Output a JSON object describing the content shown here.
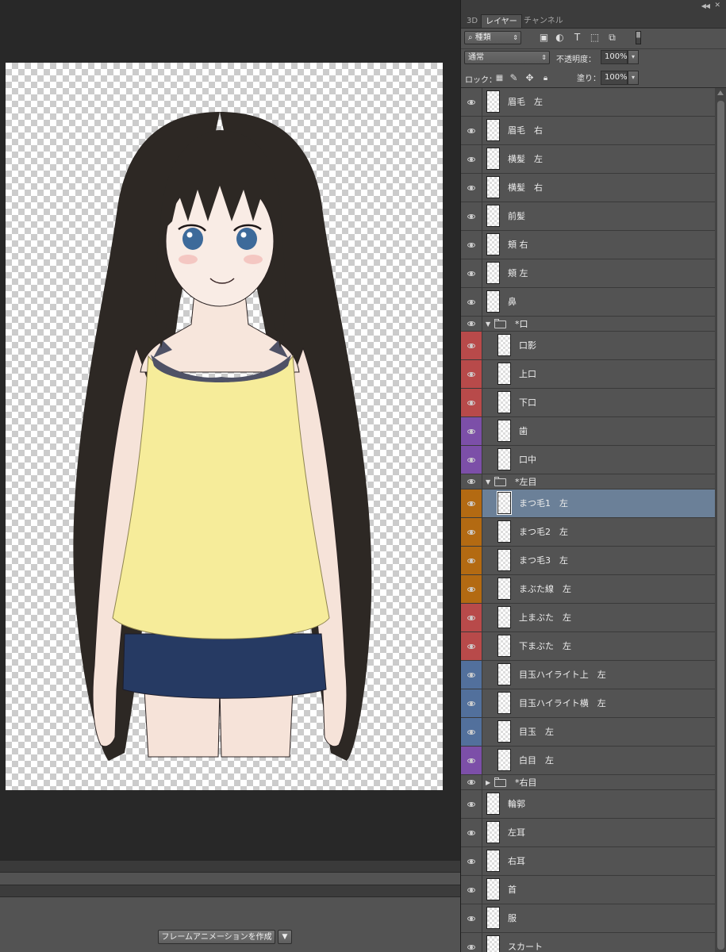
{
  "panel": {
    "tabs": [
      {
        "label": "3D"
      },
      {
        "label": "レイヤー"
      },
      {
        "label": "チャンネル"
      }
    ],
    "collapse_icon": "double-chevron-icon",
    "filter": {
      "label": "種類"
    },
    "blend_mode": {
      "value": "通常"
    },
    "opacity": {
      "label": "不透明度：",
      "value": "100%"
    },
    "lock": {
      "label": "ロック："
    },
    "fill": {
      "label": "塗り：",
      "value": "100%"
    }
  },
  "layers": [
    {
      "name": "眉毛　左",
      "color": "",
      "type": "layer"
    },
    {
      "name": "眉毛　右",
      "color": "",
      "type": "layer"
    },
    {
      "name": "横髪　左",
      "color": "",
      "type": "layer"
    },
    {
      "name": "横髪　右",
      "color": "",
      "type": "layer"
    },
    {
      "name": "前髪",
      "color": "",
      "type": "layer"
    },
    {
      "name": "頬 右",
      "color": "",
      "type": "layer"
    },
    {
      "name": "頬 左",
      "color": "",
      "type": "layer"
    },
    {
      "name": "鼻",
      "color": "",
      "type": "layer"
    },
    {
      "name": "*口",
      "color": "",
      "type": "group",
      "expanded": true
    },
    {
      "name": "口影",
      "color": "#b84a4a",
      "type": "child"
    },
    {
      "name": "上口",
      "color": "#b84a4a",
      "type": "child"
    },
    {
      "name": "下口",
      "color": "#b84a4a",
      "type": "child"
    },
    {
      "name": "歯",
      "color": "#7c4fa8",
      "type": "child"
    },
    {
      "name": "口中",
      "color": "#7c4fa8",
      "type": "child"
    },
    {
      "name": "*左目",
      "color": "",
      "type": "group",
      "expanded": true
    },
    {
      "name": "まつ毛1　左",
      "color": "#b36a12",
      "type": "child",
      "selected": true
    },
    {
      "name": "まつ毛2　左",
      "color": "#b36a12",
      "type": "child"
    },
    {
      "name": "まつ毛3　左",
      "color": "#b36a12",
      "type": "child"
    },
    {
      "name": "まぶた線　左",
      "color": "#b36a12",
      "type": "child"
    },
    {
      "name": "上まぶた　左",
      "color": "#b84a4a",
      "type": "child"
    },
    {
      "name": "下まぶた　左",
      "color": "#b84a4a",
      "type": "child"
    },
    {
      "name": "目玉ハイライト上　左",
      "color": "#52709c",
      "type": "child"
    },
    {
      "name": "目玉ハイライト横　左",
      "color": "#52709c",
      "type": "child"
    },
    {
      "name": "目玉　左",
      "color": "#52709c",
      "type": "child"
    },
    {
      "name": "白目　左",
      "color": "#7c4fa8",
      "type": "child"
    },
    {
      "name": "*右目",
      "color": "",
      "type": "group",
      "expanded": false
    },
    {
      "name": "輪郭",
      "color": "",
      "type": "layer"
    },
    {
      "name": "左耳",
      "color": "",
      "type": "layer"
    },
    {
      "name": "右耳",
      "color": "",
      "type": "layer"
    },
    {
      "name": "首",
      "color": "",
      "type": "layer"
    },
    {
      "name": "服",
      "color": "",
      "type": "layer"
    },
    {
      "name": "スカート",
      "color": "",
      "type": "layer"
    }
  ],
  "timeline": {
    "create_button": "フレームアニメーションを作成"
  }
}
